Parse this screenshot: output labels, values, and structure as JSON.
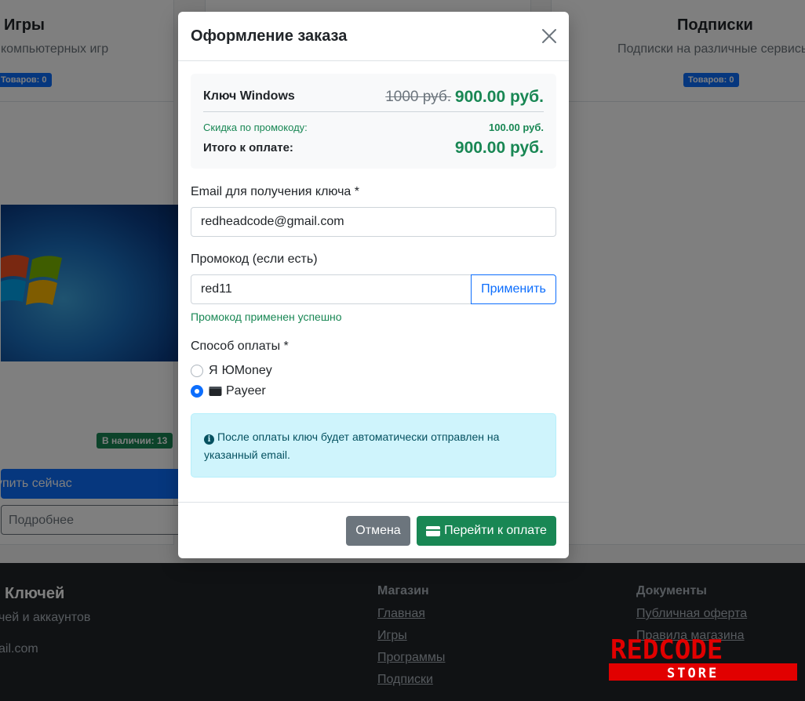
{
  "background": {
    "categories": [
      {
        "title": "Игры",
        "description": "компьютерных игр",
        "count": "Товаров: 0"
      },
      {
        "title": "Подписки",
        "description": "Подписки на различные сервисы",
        "count": "Товаров: 0"
      }
    ],
    "product": {
      "stock": "В наличии: 13",
      "buy_label": "упить сейчас",
      "details_label": "Подробнее"
    },
    "footer": {
      "brand": "Ключей",
      "tagline": "чей и аккаунтов",
      "email": "ail.com",
      "shop_title": "Магазин",
      "shop_links": [
        "Главная",
        "Игры",
        "Программы",
        "Подписки"
      ],
      "docs_title": "Документы",
      "docs_links": [
        "Публичная оферта",
        "Правила магазина"
      ]
    },
    "watermark": {
      "top": "REDCODE",
      "bottom": "STORE"
    }
  },
  "modal": {
    "title": "Оформление заказа",
    "summary": {
      "product_name": "Ключ Windows",
      "old_price": "1000 руб.",
      "new_price": "900.00 руб.",
      "discount_label": "Скидка по промокоду:",
      "discount_value": "100.00 руб.",
      "total_label": "Итого к оплате:",
      "total_value": "900.00 руб."
    },
    "email": {
      "label": "Email для получения ключа *",
      "value": "redheadcode@gmail.com"
    },
    "promo": {
      "label": "Промокод (если есть)",
      "value": "red11",
      "apply_label": "Применить",
      "success": "Промокод применен успешно"
    },
    "payment": {
      "label": "Способ оплаты *",
      "options": [
        {
          "icon": "Я",
          "label": "ЮMoney",
          "checked": false
        },
        {
          "icon": "wallet-icon",
          "label": "Payeer",
          "checked": true
        }
      ]
    },
    "alert": "После оплаты ключ будет автоматически отправлен на указанный email.",
    "buttons": {
      "cancel": "Отмена",
      "pay": "Перейти к оплате"
    }
  }
}
